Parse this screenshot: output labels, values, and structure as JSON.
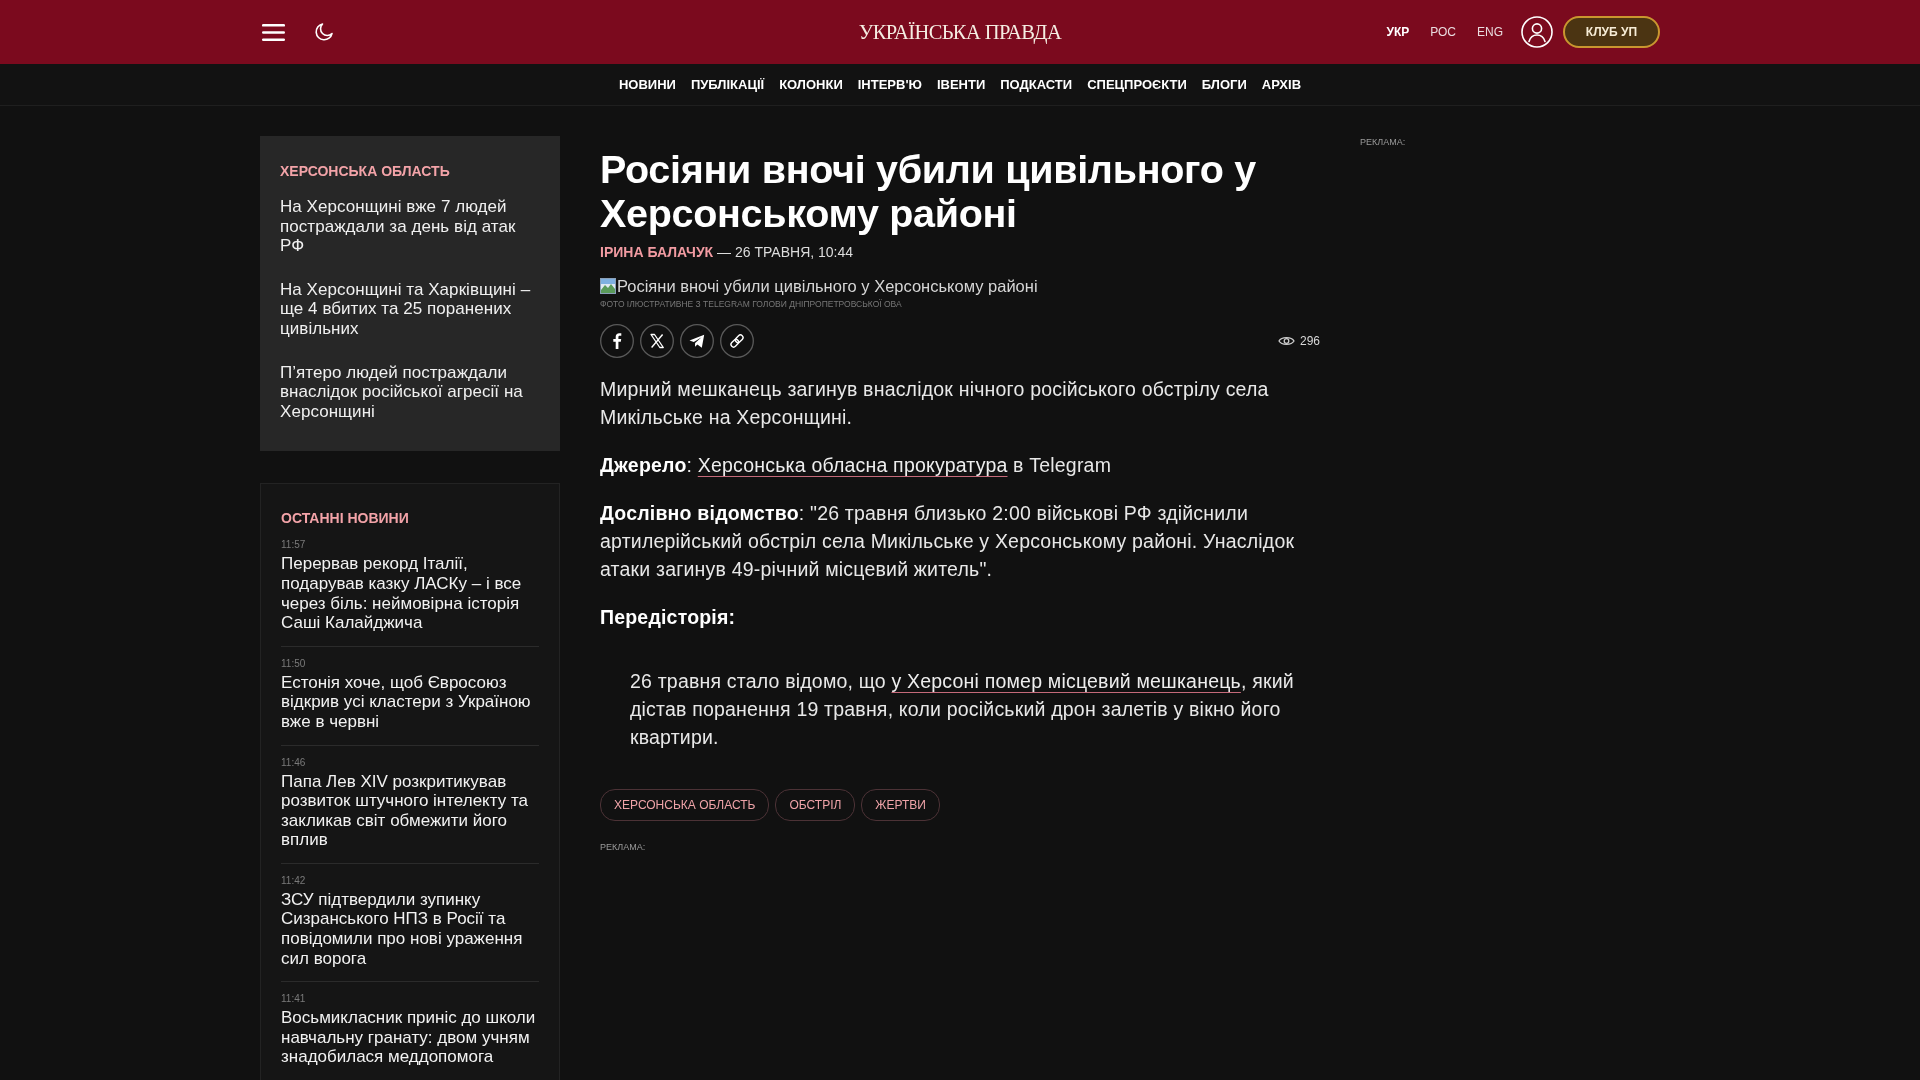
{
  "header": {
    "logo": "УКРАЇНСЬКА ПРАВДА",
    "languages": [
      {
        "label": "УКР",
        "selected": true
      },
      {
        "label": "РОС",
        "selected": false
      },
      {
        "label": "ENG",
        "selected": false
      }
    ],
    "club_button": "КЛУБ УП"
  },
  "nav": [
    "НОВИНИ",
    "ПУБЛІКАЦІЇ",
    "КОЛОНКИ",
    "ІНТЕРВ'Ю",
    "ІВЕНТИ",
    "ПОДКАСТИ",
    "СПЕЦПРОЄКТИ",
    "БЛОГИ",
    "АРХІВ"
  ],
  "topic_box": {
    "heading": "ХЕРСОНСЬКА ОБЛАСТЬ",
    "items": [
      "На Херсонщині вже 7 людей постраждали за день від атак РФ",
      "На Херсонщині та Харківщині – ще 4 вбитих та 25 поранених цивільних",
      "П’ятеро людей постраждали внаслідок російської агресії на Херсонщині"
    ]
  },
  "latest_news": {
    "heading": "ОСТАННІ НОВИНИ",
    "items": [
      {
        "time": "11:57",
        "title": "Перервав рекорд Італії, подарував казку ЛАСКу – і все через біль: неймовірна історія Саші Калайджича"
      },
      {
        "time": "11:50",
        "title": "Естонія хоче, щоб Євросоюз відкрив усі кластери з Україною вже в червні"
      },
      {
        "time": "11:46",
        "title": "Папа Лев XIV розкритикував розвиток штучного інтелекту та закликав світ обмежити його вплив"
      },
      {
        "time": "11:42",
        "title": "ЗСУ підтвердили зупинку Сизранського НПЗ в Росії та повідомили про нові ураження сил ворога"
      },
      {
        "time": "11:41",
        "title": "Восьмикласник приніс до школи навчальну гранату: двом учням знадобилася меддопомога"
      }
    ]
  },
  "article": {
    "title": "Росіяни вночі убили цивільного у Херсонському районі",
    "author": "ІРИНА БАЛАЧУК",
    "date": "— 26 ТРАВНЯ, 10:44",
    "image": {
      "alt_text": "Росіяни вночі убили цивільного у Херсонському районі",
      "caption": "ФОТО ІЛЮСТРАТИВНЕ З TELEGRAM ГОЛОВИ ДНІПРОПЕТРОВСЬКОЇ ОВА"
    },
    "views": "296",
    "paragraphs": [
      {
        "kind": "text",
        "text": "Мирний мешканець загинув внаслідок нічного російського обстрілу села Микільське на Херсонщині."
      },
      {
        "kind": "text",
        "text": "**Джерело**: ",
        "link": "Херсонська обласна прокуратура",
        "after": " в Telegram"
      },
      {
        "kind": "text",
        "text": "**Дослівно відомство**: \"26 травня близько 2:00 військові РФ здійснили артилерійський обстріл села Микільське у Херсонському районі. Унаслідок атаки загинув 49-річний місцевий житель\"."
      },
      {
        "kind": "subheading",
        "text": "Передісторія:"
      },
      {
        "kind": "quote",
        "text": "26 травня стало відомо, що ",
        "link": "у Херсоні помер місцевий мешканець",
        "after": ", який дістав поранення 19 травня, коли російський дрон залетів у вікно його квартири."
      }
    ],
    "tags": [
      "ХЕРСОНСЬКА ОБЛАСТЬ",
      "ОБСТРІЛ",
      "ЖЕРТВИ"
    ],
    "ad_label": "РЕКЛАМА:"
  },
  "right_ad": {
    "label": "РЕКЛАМА:"
  }
}
